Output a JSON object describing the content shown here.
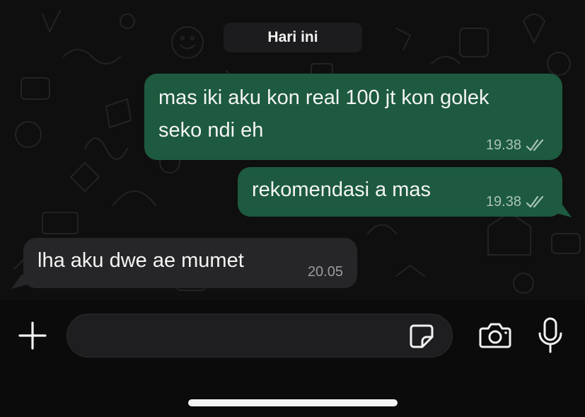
{
  "chat": {
    "date_label": "Hari ini",
    "messages": [
      {
        "direction": "outgoing",
        "lines": [
          "mas iki aku kon real 100 jt kon golek",
          "seko ndi eh"
        ],
        "time": "19.38",
        "status": "read"
      },
      {
        "direction": "outgoing",
        "lines": [
          "rekomendasi a mas"
        ],
        "time": "19.38",
        "status": "read"
      },
      {
        "direction": "incoming",
        "lines": [
          "lha aku dwe ae mumet"
        ],
        "time": "20.05"
      }
    ]
  },
  "composer": {
    "input_value": "",
    "attach_icon": "plus-icon",
    "sticker_icon": "sticker-icon",
    "camera_icon": "camera-icon",
    "mic_icon": "microphone-icon"
  },
  "colors": {
    "outgoing_bubble": "#1d5a3f",
    "incoming_bubble": "#262628",
    "background": "#0f0f0f",
    "read_tick": "#a9c4b6"
  }
}
